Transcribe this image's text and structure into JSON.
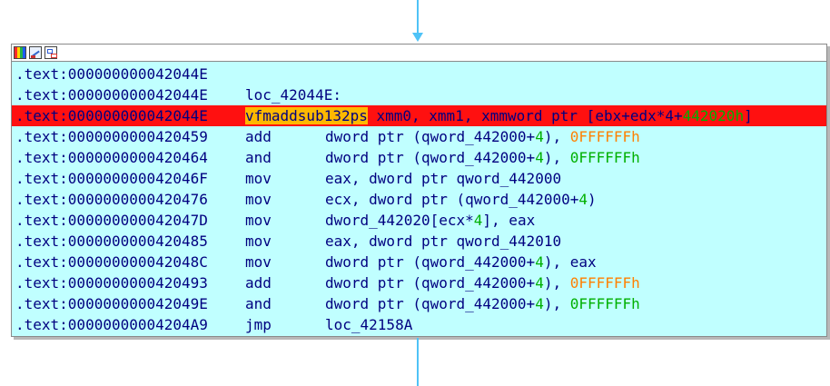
{
  "titlebar": {
    "icons": [
      "color-palette-icon",
      "edit-node-icon",
      "graph-view-icon"
    ]
  },
  "lines": [
    {
      "addr": ".text:000000000042044E",
      "mn": "",
      "label": "",
      "ops": [],
      "sel": false
    },
    {
      "addr": ".text:000000000042044E",
      "mn": "",
      "label": "loc_42044E:",
      "ops": [],
      "sel": false
    },
    {
      "addr": ".text:000000000042044E",
      "mn": "vfmaddsub132ps",
      "label": "",
      "ops": [
        {
          "t": " xmm0, xmm1, xmmword ptr [ebx+edx*4+",
          "c": ""
        },
        {
          "t": "442020h",
          "c": "num"
        },
        {
          "t": "]",
          "c": ""
        }
      ],
      "sel": true
    },
    {
      "addr": ".text:0000000000420459",
      "mn": "add",
      "label": "",
      "ops": [
        {
          "t": "dword ptr (qword_442000+",
          "c": ""
        },
        {
          "t": "4",
          "c": "num"
        },
        {
          "t": "), ",
          "c": ""
        },
        {
          "t": "0FFFFFFh",
          "c": "num-orange"
        }
      ],
      "sel": false
    },
    {
      "addr": ".text:0000000000420464",
      "mn": "and",
      "label": "",
      "ops": [
        {
          "t": "dword ptr (qword_442000+",
          "c": ""
        },
        {
          "t": "4",
          "c": "num"
        },
        {
          "t": "), ",
          "c": ""
        },
        {
          "t": "0FFFFFFh",
          "c": "num"
        }
      ],
      "sel": false
    },
    {
      "addr": ".text:000000000042046F",
      "mn": "mov",
      "label": "",
      "ops": [
        {
          "t": "eax, dword ptr qword_442000",
          "c": ""
        }
      ],
      "sel": false
    },
    {
      "addr": ".text:0000000000420476",
      "mn": "mov",
      "label": "",
      "ops": [
        {
          "t": "ecx, dword ptr (qword_442000+",
          "c": ""
        },
        {
          "t": "4",
          "c": "num"
        },
        {
          "t": ")",
          "c": ""
        }
      ],
      "sel": false
    },
    {
      "addr": ".text:000000000042047D",
      "mn": "mov",
      "label": "",
      "ops": [
        {
          "t": "dword_442020[ecx*",
          "c": ""
        },
        {
          "t": "4",
          "c": "num"
        },
        {
          "t": "], eax",
          "c": ""
        }
      ],
      "sel": false
    },
    {
      "addr": ".text:0000000000420485",
      "mn": "mov",
      "label": "",
      "ops": [
        {
          "t": "eax, dword ptr qword_442010",
          "c": ""
        }
      ],
      "sel": false
    },
    {
      "addr": ".text:000000000042048C",
      "mn": "mov",
      "label": "",
      "ops": [
        {
          "t": "dword ptr (qword_442000+",
          "c": ""
        },
        {
          "t": "4",
          "c": "num"
        },
        {
          "t": "), eax",
          "c": ""
        }
      ],
      "sel": false
    },
    {
      "addr": ".text:0000000000420493",
      "mn": "add",
      "label": "",
      "ops": [
        {
          "t": "dword ptr (qword_442000+",
          "c": ""
        },
        {
          "t": "4",
          "c": "num"
        },
        {
          "t": "), ",
          "c": ""
        },
        {
          "t": "0FFFFFFh",
          "c": "num-orange"
        }
      ],
      "sel": false
    },
    {
      "addr": ".text:000000000042049E",
      "mn": "and",
      "label": "",
      "ops": [
        {
          "t": "dword ptr (qword_442000+",
          "c": ""
        },
        {
          "t": "4",
          "c": "num"
        },
        {
          "t": "), ",
          "c": ""
        },
        {
          "t": "0FFFFFFh",
          "c": "num"
        }
      ],
      "sel": false
    },
    {
      "addr": ".text:00000000004204A9",
      "mn": "jmp",
      "label": "",
      "ops": [
        {
          "t": "loc_42158A",
          "c": ""
        }
      ],
      "sel": false
    }
  ],
  "colors": {
    "node_bg": "#c0ffff",
    "selection": "#ff1010",
    "mnemonic_highlight": "#ffb800",
    "edge": "#4fc3f7",
    "text": "#000080",
    "number_green": "#00b000",
    "number_orange": "#ff8000"
  }
}
